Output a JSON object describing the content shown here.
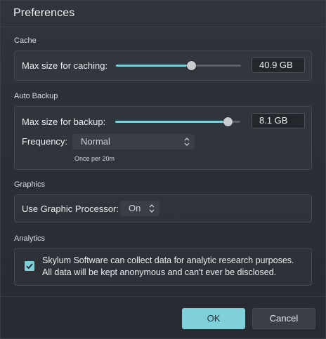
{
  "dialog": {
    "title": "Preferences"
  },
  "cache": {
    "section_label": "Cache",
    "max_size_label": "Max size for caching:",
    "slider_fraction": 0.6,
    "value": "40.9 GB"
  },
  "auto_backup": {
    "section_label": "Auto Backup",
    "max_size_label": "Max size for backup:",
    "slider_fraction": 0.9,
    "value": "8.1 GB",
    "frequency_label": "Frequency:",
    "frequency_value": "Normal",
    "frequency_hint": "Once per 20m"
  },
  "graphics": {
    "section_label": "Graphics",
    "use_gpu_label": "Use Graphic Processor:",
    "use_gpu_value": "On"
  },
  "analytics": {
    "section_label": "Analytics",
    "checked": true,
    "line1": "Skylum Software can collect data for analytic research purposes.",
    "line2": "All data will be kept anonymous and can't ever be disclosed."
  },
  "footer": {
    "ok_label": "OK",
    "cancel_label": "Cancel"
  },
  "colors": {
    "accent": "#7fd0d9",
    "background": "#2a2e34"
  }
}
